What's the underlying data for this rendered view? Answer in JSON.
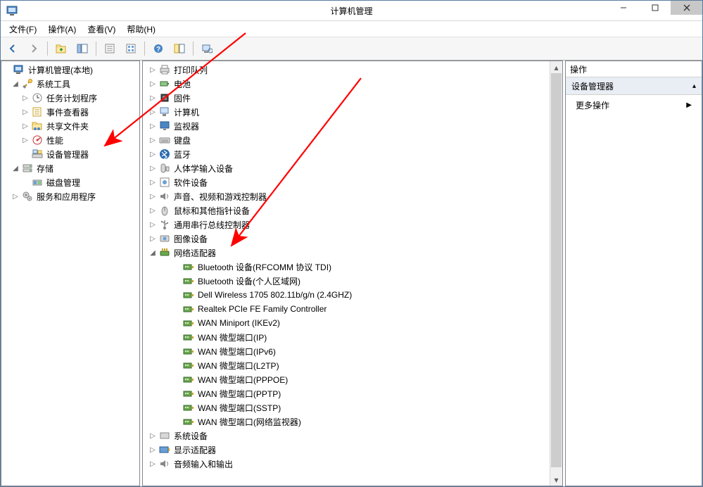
{
  "window": {
    "title": "计算机管理"
  },
  "menu": {
    "file": "文件(F)",
    "action": "操作(A)",
    "view": "查看(V)",
    "help": "帮助(H)"
  },
  "toolbar": {
    "back": "back",
    "forward": "forward",
    "up": "up-folder",
    "show_hide": "show-hide-tree",
    "properties": "properties",
    "refresh": "refresh",
    "help": "help",
    "btn7": "btn7",
    "btn8": "btn8"
  },
  "left_tree": {
    "root": "计算机管理(本地)",
    "sys_tools": "系统工具",
    "task_sched": "任务计划程序",
    "event_viewer": "事件查看器",
    "shared_folders": "共享文件夹",
    "performance": "性能",
    "device_mgr": "设备管理器",
    "storage": "存储",
    "disk_mgmt": "磁盘管理",
    "services_apps": "服务和应用程序"
  },
  "mid_tree": {
    "print_queues": "打印队列",
    "batteries": "电池",
    "firmware": "固件",
    "computer": "计算机",
    "monitors": "监视器",
    "keyboards": "键盘",
    "bluetooth": "蓝牙",
    "hid": "人体学输入设备",
    "software_devices": "软件设备",
    "sound": "声音、视频和游戏控制器",
    "mice": "鼠标和其他指针设备",
    "usb": "通用串行总线控制器",
    "imaging": "图像设备",
    "network_adapters": "网络适配器",
    "na_children": [
      "Bluetooth 设备(RFCOMM 协议 TDI)",
      "Bluetooth 设备(个人区域网)",
      "Dell Wireless 1705 802.11b/g/n (2.4GHZ)",
      "Realtek PCIe FE Family Controller",
      "WAN Miniport (IKEv2)",
      "WAN 微型端口(IP)",
      "WAN 微型端口(IPv6)",
      "WAN 微型端口(L2TP)",
      "WAN 微型端口(PPPOE)",
      "WAN 微型端口(PPTP)",
      "WAN 微型端口(SSTP)",
      "WAN 微型端口(网络监视器)"
    ],
    "system_devices": "系统设备",
    "display_adapters": "显示适配器",
    "audio_io": "音频输入和输出"
  },
  "right": {
    "header": "操作",
    "section": "设备管理器",
    "more_actions": "更多操作"
  }
}
